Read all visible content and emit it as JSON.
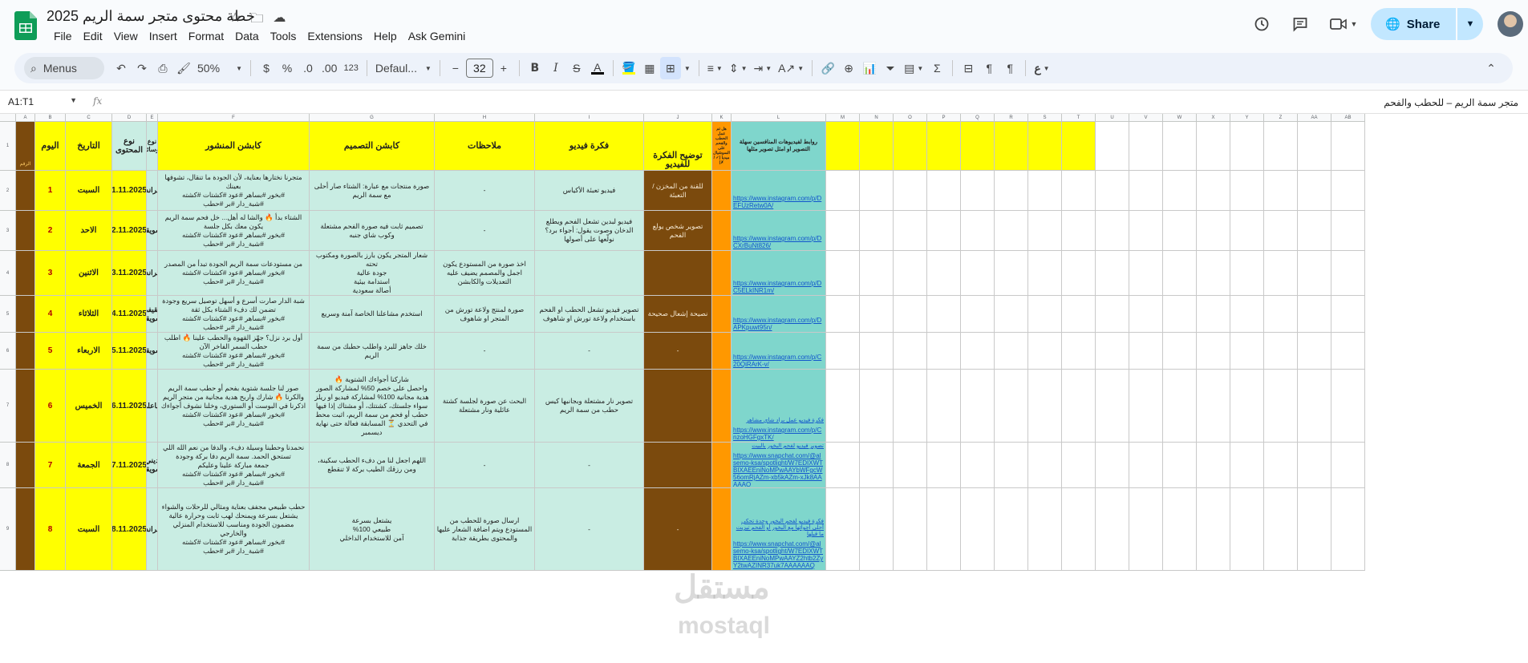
{
  "app": {
    "title": "خطة محتوى متجر سمة الريم 2025",
    "menu": [
      "File",
      "Edit",
      "View",
      "Insert",
      "Format",
      "Data",
      "Tools",
      "Extensions",
      "Help",
      "Ask Gemini"
    ],
    "share_label": "Share"
  },
  "toolbar": {
    "menus_label": "Menus",
    "zoom": "50%",
    "currency": "$",
    "percent": "%",
    "dec_decrease": ".0",
    "dec_increase": ".00",
    "number_format": "123",
    "font": "Defaul...",
    "font_size": "32"
  },
  "formula_bar": {
    "name_box": "A1:T1",
    "fx": "fx",
    "content": "متجر سمة الريم – للحطب والفحم"
  },
  "colors": {
    "yellow": "#ffff00",
    "teal": "#c9ede3",
    "brown": "#7b4a0d",
    "orange": "#ff9800",
    "aqua": "#7fd6cc",
    "share": "#c2e7ff"
  },
  "grid": {
    "col_letters": [
      "A",
      "B",
      "C",
      "D",
      "E",
      "F",
      "G",
      "H",
      "I",
      "J",
      "K",
      "L",
      "M",
      "N",
      "O",
      "P",
      "Q",
      "R",
      "S",
      "T",
      "U",
      "V",
      "W",
      "X",
      "Y",
      "Z",
      "AA",
      "AB"
    ],
    "row_numbers": [
      "1",
      "2",
      "3",
      "4",
      "5",
      "6",
      "7",
      "8",
      "9"
    ],
    "header": {
      "a": "الرقم",
      "b": "اليوم",
      "c": "التاريخ",
      "d": "نوع المحتوى",
      "e": "نوع الوسائط",
      "f": "كابشن المنشور",
      "g": "كابشن التصميم",
      "h": "ملاحظات",
      "i": "فكرة فيديو",
      "j": "توضيح الفكرة للفيديو",
      "k": "هل تم عمل الحطب والفحم على السوشيال ميديا (✓ / ✗)",
      "l": "روابط لفيديوهات المنافسين سهلة التصوير او امثل تصوير مثلها"
    },
    "rows": [
      {
        "n": "1",
        "day": "السبت",
        "date": "1.11.2025",
        "type": "براند",
        "caption": "متجرنا نختارها بعناية، لأن الجودة ما تنقال، تشوفها بعينك\n#بخور #بساهر #عود #كشتات #كشته\n#شبة_دار #بر #حطب",
        "design": "صورة منتجات مع عبارة: الشتاء صار أحلى مع سمة الريم",
        "notes": "-",
        "video": "فيديو تعبئة الأكياس",
        "explain": "للقنة من المخزن / التعبئة",
        "link": "https://www.instagram.com/p/DEFUzRetw0A/"
      },
      {
        "n": "2",
        "day": "الاحد",
        "date": "2.11.2025",
        "type": "تسويقي",
        "caption": "الشتاء بدأ 🔥 والشا له أهل... خل فحم سمة الريم يكون معك بكل جلسة\n#بخور #بساهر #عود #كشتات #كشته\n#شبة_دار #بر #حطب",
        "design": "تصميم ثابت فيه صورة الفحم مشتعلة وكوب شاي جنبه",
        "notes": "-",
        "video": "فيديو لبدين تشعل الفحم ويطلع الدخان وصوت يقول: أجواء برد؟ نولّعها على أصولها",
        "explain": "تصوير شخص يولع الفحم",
        "link": "https://www.instagram.com/p/DCXrBuNt826/"
      },
      {
        "n": "3",
        "day": "الاثنين",
        "date": "3.11.2025",
        "type": "براند",
        "caption": "من مستودعات سمة الريم الجودة تبدأ من المصدر\n#بخور #بساهر #عود #كشتات #كشته\n#شبة_دار #بر #حطب",
        "design": "شعار المتجر يكون بارز بالصورة ومكتوب تحته\nجودة عالية\nاستدامة بيئية\nأصالة سعودية",
        "notes": "اخذ صورة من المستودع يكون اجمل والمصمم يضيف عليه التعديلات والكابشن",
        "video": "",
        "explain": "",
        "link": "https://www.instagram.com/p/DC5ELkINR1m/"
      },
      {
        "n": "4",
        "day": "الثلاثاء",
        "date": "4.11.2025",
        "type": "تثقيفي تسويقي",
        "caption": "شبة الدار صارت أسرع و أسهل توصيل سريع وجودة تضمن لك دفء الشتاء بكل ثقة\n#بخور #بساهر #عود #كشتات #كشته\n#شبة_دار #بر #حطب",
        "design": "استخدم مشاعلنا الخاصة آمنة وسريع",
        "notes": "صورة لمنتج ولاعة تورش من المتجر او شاهوف",
        "video": "تصوير فيديو تشعل الحطب او الفحم باستخدام ولاعة تورش او شاهوف",
        "explain": "نصيحة إشعال صحيحة",
        "link": "https://www.instagram.com/p/DAPKpuwt95n/"
      },
      {
        "n": "5",
        "day": "الاربعاء",
        "date": "5.11.2025",
        "type": "تسويقي",
        "caption": "أول برد نزل؟ جهّز القهوة والحطب علينا 🔥 اطلب حطب السمر الفاخر الآن\n#بخور #بساهر #عود #كشتات #كشته\n#شبة_دار #بر #حطب",
        "design": "خلك جاهز للبرد واطلب حطبك من سمة الريم",
        "notes": "-",
        "video": "-",
        "explain": "-",
        "link": "https://www.instagram.com/p/C20QiRArK-v/"
      },
      {
        "n": "6",
        "day": "الخميس",
        "date": "6.11.2025",
        "type": "تفاعلي",
        "caption": "صور لنا جلسة شتوية بفحم أو حطب سمة الريم والكرنا 🔥 شارك واربح هدية مجانية من متجر الريم اذكرنا في البوست أو الستوري، وخلنا نشوف أجواءك\n#بخور #بساهر #عود #كشتات #كشته\n#شبة_دار #بر #حطب",
        "design": "شاركنا أجواءك الشتوية 🔥\nواحصل على خصم 50% لمشاركة الصور\nهدية مجانية 100% لمشاركة فيديو او ريلز\nسواء جلستك، كشتتك، أو مشتاك إذا فيها حطب أو فحم من سمة الريم، اثبت محط في التحدي ⏳ المسابقة فعالة حتى نهاية ديسمبر",
        "notes": "البحث عن صورة لجلسة كشتة عائلية ونار مشتعلة",
        "video": "تصوير نار مشتعلة وبجانبها كيس حطب من سمة الريم",
        "explain": "",
        "link": "https://www.instagram.com/p/CnzoHGFgxTK/",
        "link_note": "فكرة فيديو عمل براد شاي مشاهر"
      },
      {
        "n": "7",
        "day": "الجمعة",
        "date": "7.11.2025",
        "type": "ديني تسويقي",
        "caption": "نحمدنا وحطبنا وسيلة دفء، والدفا من نعم الله اللي تستحق الحمد. سمة الريم دفا بركة وجودة\nجمعة مباركة علينا وعليكم\n#بخور #بساهر #عود #كشتات #كشته\n#شبة_دار #بر #حطب",
        "design": "اللهم اجعل لنا من دفء الحطب سكينة، ومن رزقك الطيب بركة لا تنقطع",
        "notes": "-",
        "video": "-",
        "explain": "",
        "link": "https://www.snapchat.com/@alsemo-ksa/spotlight/W7EDIXWTBIXAEEniNoMPwAAYbWFgcW56omRjAZm-xb5kAZm-xJk8AAAAAQ",
        "link_note": "تصوير فيديو لفحم البخور بالبيت"
      },
      {
        "n": "8",
        "day": "السبت",
        "date": "8.11.2025",
        "type": "براند",
        "caption": "حطب طبيعي مجفف بعناية ومثالي للرحلات والشواء يشتعل بسرعة ويمنحك لهب ثابت وحرارة عالية مضمون الجودة ومناسب للاستخدام المنزلي والخارجي\n#بخور #بساهر #عود #كشتات #كشته\n#شبة_دار #بر #حطب",
        "design": "يشتعل بسرعة\nطبيعي 100%\nآمن للاستخدام الداخلي",
        "notes": "ارسال صورة للحطب من المستودع ويتم اضافة الشعار عليها والمحتوى بطريقة جذابة",
        "video": "-",
        "explain": "-",
        "link": "https://www.snapchat.com/@alsemo-ksa/spotlight/W7EDIXWTBIXAEEniNoMPwAAYZ2htb2ZyY2twAZINR37uk7AAAAAAQ",
        "link_note": "فكرة فيديو لفحم البخور وحدة تحكي أحلى أجوائها مع البخور أو الفحم تيزيت ما قبلها"
      }
    ]
  },
  "watermark": {
    "line1": "مستقل",
    "line2": "mostaql"
  }
}
